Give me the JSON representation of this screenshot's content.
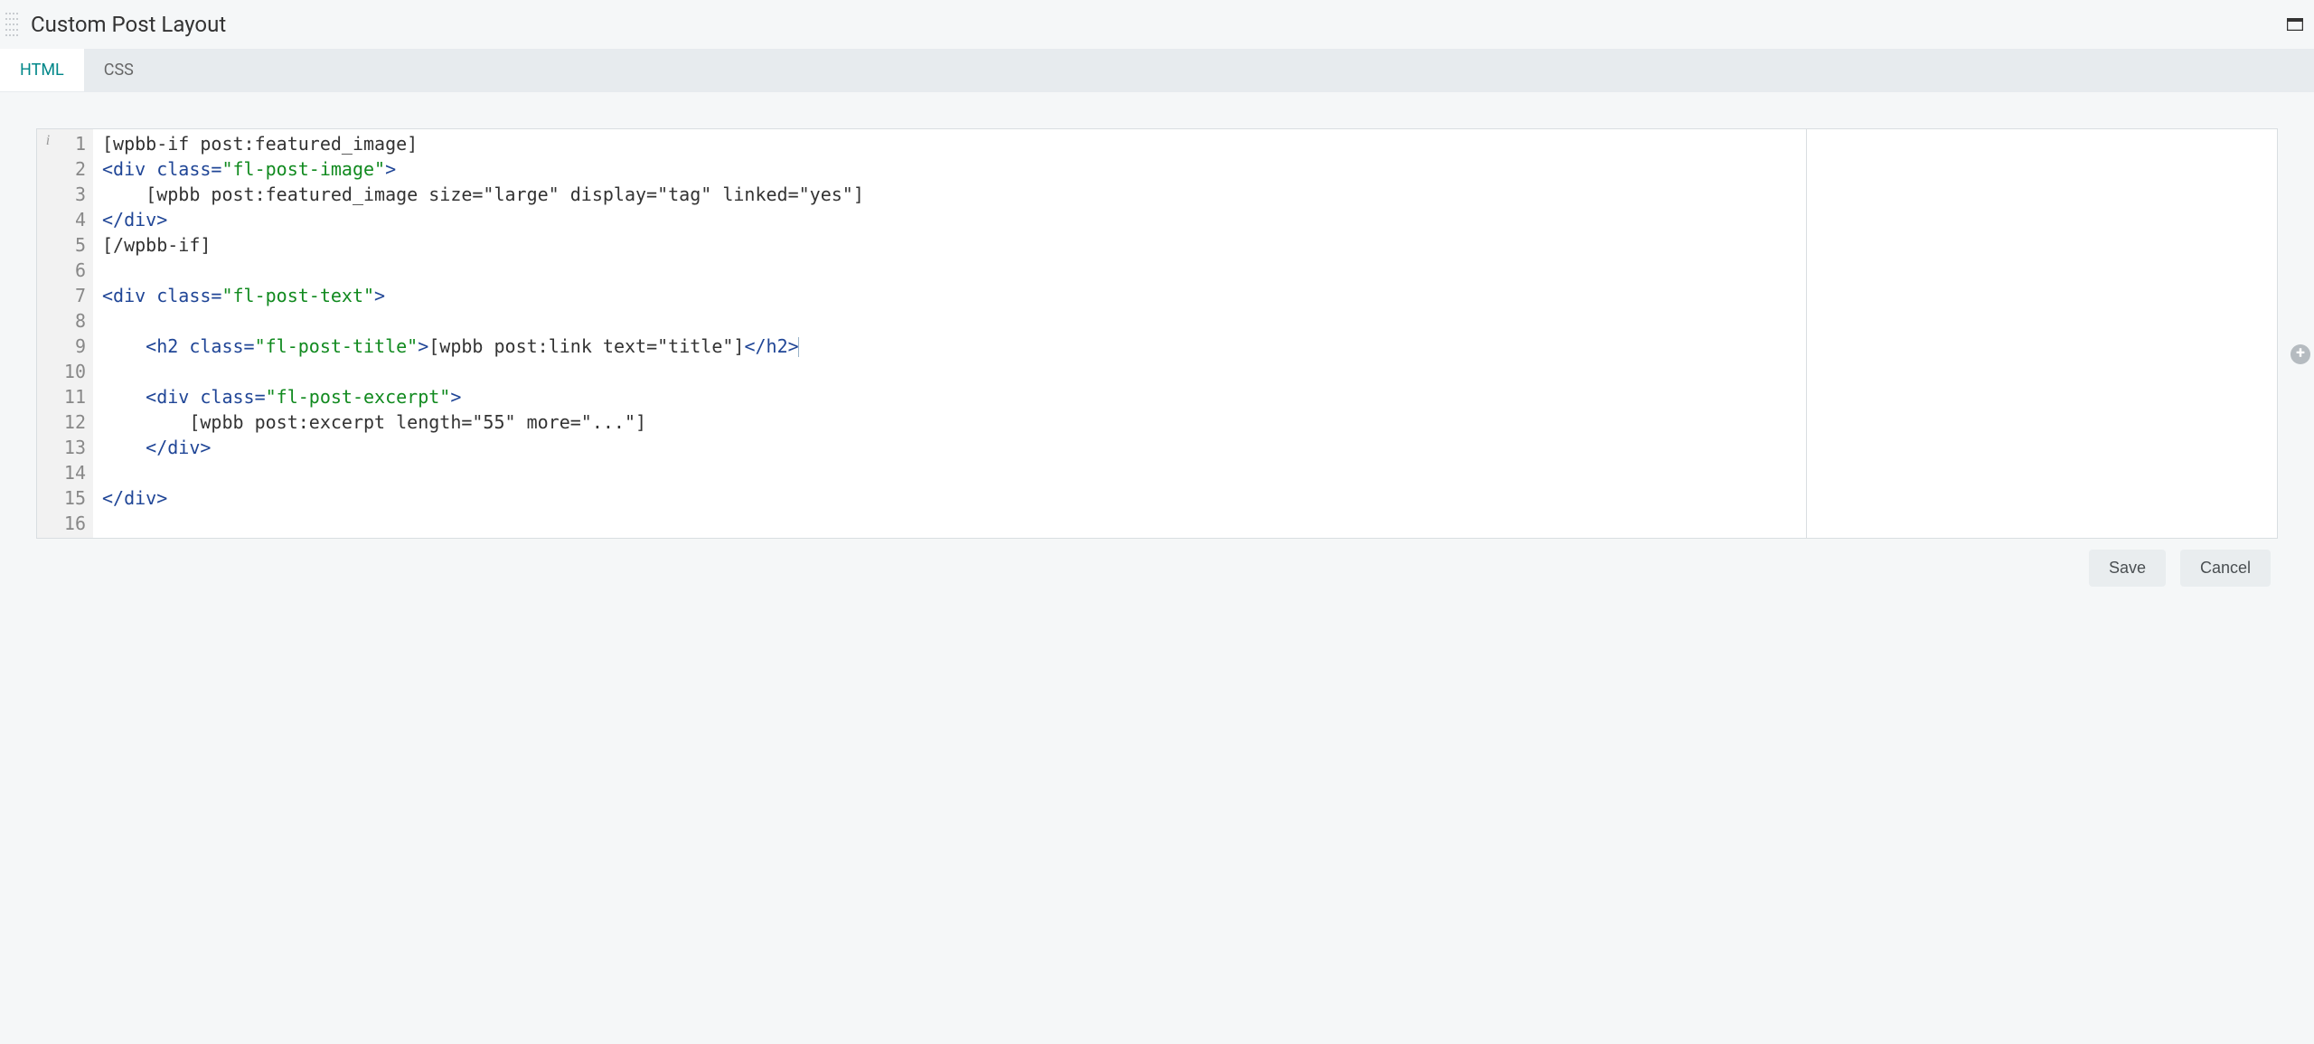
{
  "header": {
    "title": "Custom Post Layout"
  },
  "tabs": [
    {
      "id": "html",
      "label": "HTML",
      "active": true
    },
    {
      "id": "css",
      "label": "CSS",
      "active": false
    }
  ],
  "gutter_info_glyph": "i",
  "line_numbers": [
    "1",
    "2",
    "3",
    "4",
    "5",
    "6",
    "7",
    "8",
    "9",
    "10",
    "11",
    "12",
    "13",
    "14",
    "15",
    "16"
  ],
  "code_lines": [
    [
      {
        "cls": "tok-text",
        "text": "[wpbb-if post:featured_image]"
      }
    ],
    [
      {
        "cls": "tok-tag",
        "text": "<div "
      },
      {
        "cls": "tok-attr",
        "text": "class="
      },
      {
        "cls": "tok-string",
        "text": "\"fl-post-image\""
      },
      {
        "cls": "tok-tag",
        "text": ">"
      }
    ],
    [
      {
        "cls": "tok-text",
        "text": "    [wpbb post:featured_image size=\"large\" display=\"tag\" linked=\"yes\"]"
      }
    ],
    [
      {
        "cls": "tok-tag",
        "text": "</div>"
      }
    ],
    [
      {
        "cls": "tok-text",
        "text": "[/wpbb-if]"
      }
    ],
    [
      {
        "cls": "tok-text",
        "text": ""
      }
    ],
    [
      {
        "cls": "tok-tag",
        "text": "<div "
      },
      {
        "cls": "tok-attr",
        "text": "class="
      },
      {
        "cls": "tok-string",
        "text": "\"fl-post-text\""
      },
      {
        "cls": "tok-tag",
        "text": ">"
      }
    ],
    [
      {
        "cls": "tok-text",
        "text": ""
      }
    ],
    [
      {
        "cls": "tok-tag",
        "text": "    <h2 "
      },
      {
        "cls": "tok-attr",
        "text": "class="
      },
      {
        "cls": "tok-string",
        "text": "\"fl-post-title\""
      },
      {
        "cls": "tok-tag",
        "text": ">"
      },
      {
        "cls": "tok-text",
        "text": "[wpbb post:link text=\"title\"]"
      },
      {
        "cls": "tok-tag",
        "text": "</h2>"
      }
    ],
    [
      {
        "cls": "tok-text",
        "text": ""
      }
    ],
    [
      {
        "cls": "tok-tag",
        "text": "    <div "
      },
      {
        "cls": "tok-attr",
        "text": "class="
      },
      {
        "cls": "tok-string",
        "text": "\"fl-post-excerpt\""
      },
      {
        "cls": "tok-tag",
        "text": ">"
      }
    ],
    [
      {
        "cls": "tok-text",
        "text": "        [wpbb post:excerpt length=\"55\" more=\"...\"]"
      }
    ],
    [
      {
        "cls": "tok-tag",
        "text": "    </div>"
      }
    ],
    [
      {
        "cls": "tok-text",
        "text": ""
      }
    ],
    [
      {
        "cls": "tok-tag",
        "text": "</div>"
      }
    ],
    [
      {
        "cls": "tok-text",
        "text": ""
      }
    ]
  ],
  "cursor_line_index": 8,
  "footer": {
    "save_label": "Save",
    "cancel_label": "Cancel"
  }
}
